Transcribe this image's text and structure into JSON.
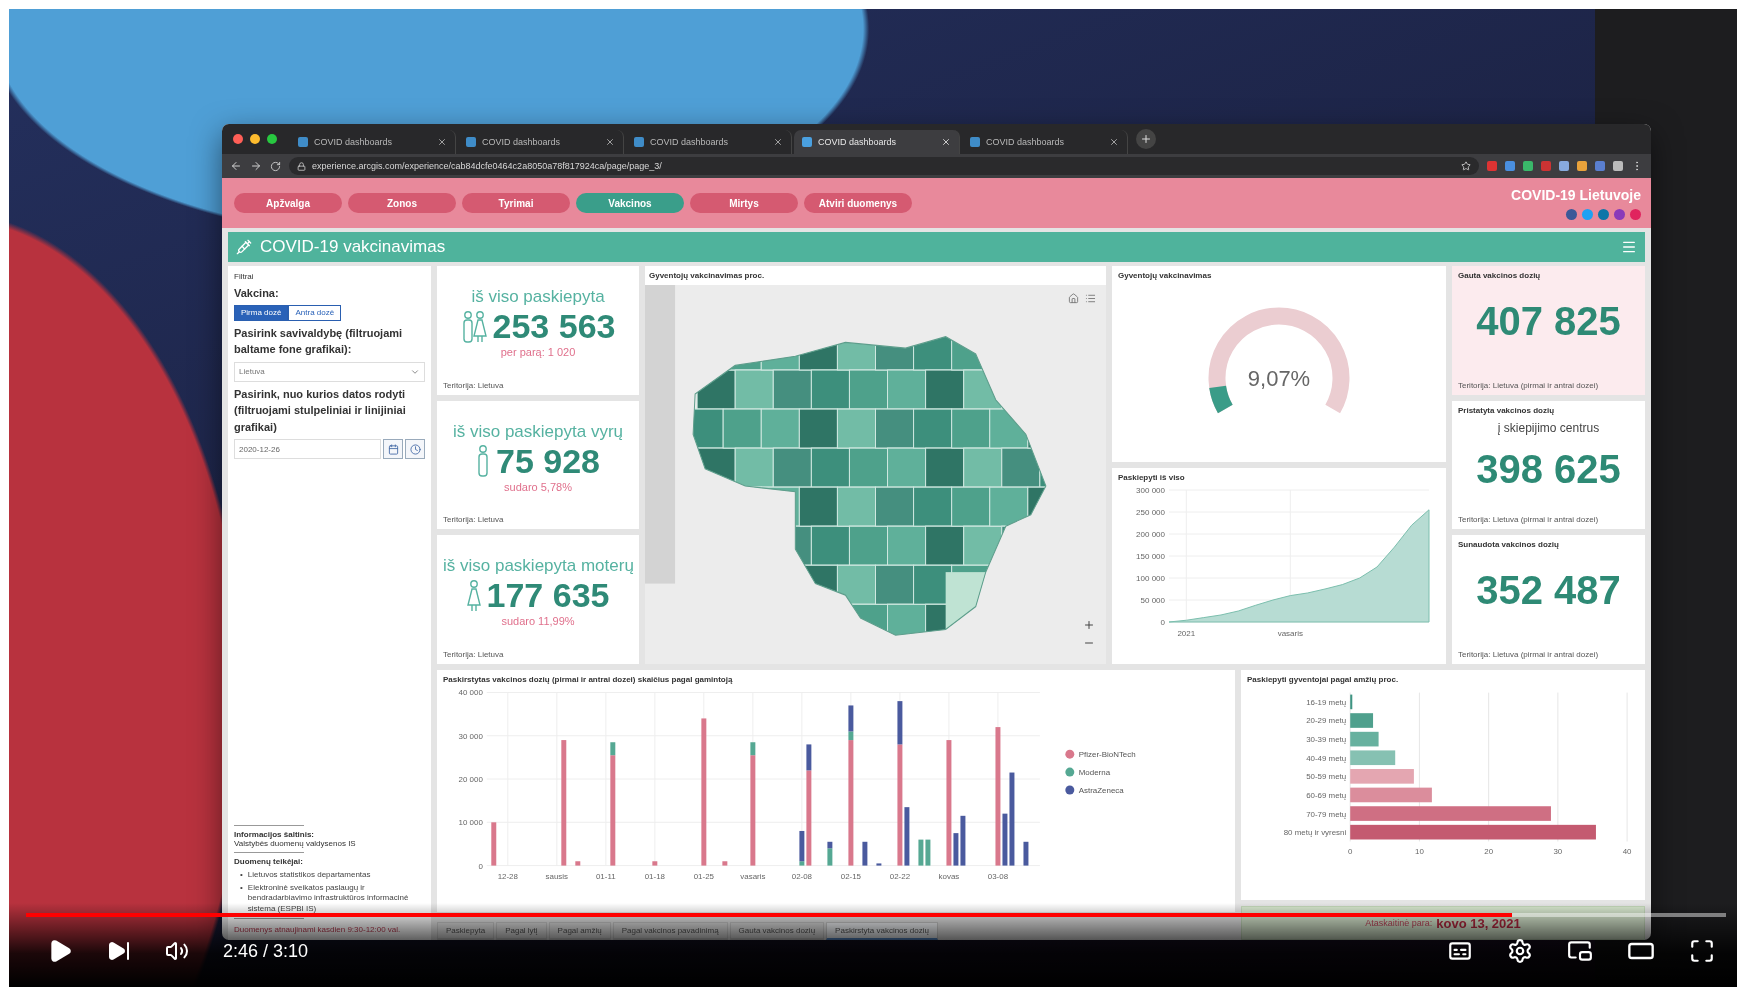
{
  "browser": {
    "tabs": [
      {
        "title": "COVID dashboards",
        "selected": false
      },
      {
        "title": "COVID dashboards",
        "selected": false
      },
      {
        "title": "COVID dashboards",
        "selected": false
      },
      {
        "title": "COVID dashboards",
        "selected": true
      },
      {
        "title": "COVID dashboards",
        "selected": false
      }
    ],
    "url": "experience.arcgis.com/experience/cab84dcfe0464c2a8050a78f817924ca/page/page_3/"
  },
  "nav": {
    "items": [
      {
        "label": "Apžvalga",
        "selected": false
      },
      {
        "label": "Zonos",
        "selected": false
      },
      {
        "label": "Tyrimai",
        "selected": false
      },
      {
        "label": "Vakcinos",
        "selected": true
      },
      {
        "label": "Mirtys",
        "selected": false
      },
      {
        "label": "Atviri duomenys",
        "selected": false
      }
    ],
    "site_title": "COVID-19 Lietuvoje"
  },
  "header": {
    "title": "COVID-19 vakcinavimas"
  },
  "filters": {
    "title": "Filtrai",
    "vaccine_label": "Vakcina:",
    "dose_options": [
      {
        "label": "Pirma dozė",
        "selected": true
      },
      {
        "label": "Antra dozė",
        "selected": false
      }
    ],
    "municipality_label": "Pasirink savivaldybę (filtruojami baltame fone grafikai):",
    "municipality_value": "Lietuva",
    "date_label": "Pasirink, nuo kurios datos rodyti (filtruojami stulpeliniai ir linijiniai grafikai)",
    "date_value": "2020-12-26",
    "source_label": "Informacijos šaltinis:",
    "source_value": "Valstybės duomenų valdysenos IS",
    "providers_label": "Duomenų teikėjai:",
    "providers": [
      {
        "marker": "•",
        "text": "Lietuvos statistikos departamentas"
      },
      {
        "marker": "•",
        "text": "Elektroninė sveikatos paslaugų ir bendradarbiavimo infrastruktūros informacinė sistema (ESPBI IS)"
      }
    ],
    "update_note": "Duomenys atnaujinami kasdien 9:30-12:00 val."
  },
  "kpis": [
    {
      "kind": "group",
      "title": "iš viso paskiepyta",
      "value": "253 563",
      "note": "per parą: 1 020",
      "footer": "Teritorija: Lietuva"
    },
    {
      "kind": "male",
      "title": "iš viso paskiepyta vyrų",
      "value": "75 928",
      "note": "sudaro 5,78%",
      "footer": "Teritorija: Lietuva"
    },
    {
      "kind": "female",
      "title": "iš viso paskiepyta moterų",
      "value": "177 635",
      "note": "sudaro 11,99%",
      "footer": "Teritorija: Lietuva"
    }
  ],
  "map": {
    "title": "Gyventojų vakcinavimas proc."
  },
  "gauge": {
    "title": "Gyventojų vakcinavimas",
    "level": 0.0907,
    "reading": "9,07%"
  },
  "line_chart": {
    "chart_data": {
      "type": "area",
      "title": "Paskiepyti iš viso",
      "categories": [
        null,
        "2021",
        null,
        null,
        null,
        null,
        null,
        "vasaris",
        null,
        null,
        null,
        null,
        null,
        null,
        null,
        null
      ],
      "series": [
        {
          "color": "#b7dcd3",
          "values": [
            0,
            4000,
            10000,
            16000,
            25000,
            38000,
            50000,
            60000,
            66000,
            75000,
            85000,
            100000,
            125000,
            170000,
            220000,
            255000
          ]
        }
      ],
      "ylim": [
        0,
        300000
      ],
      "grid": true,
      "yticks": [
        {
          "value": 0,
          "label": "0"
        },
        {
          "value": 50000,
          "label": "50 000"
        },
        {
          "value": 100000,
          "label": "100 000"
        },
        {
          "value": 150000,
          "label": "150 000"
        },
        {
          "value": 200000,
          "label": "200 000"
        },
        {
          "value": 250000,
          "label": "250 000"
        },
        {
          "value": 300000,
          "label": "300 000"
        }
      ]
    }
  },
  "dose_cards": [
    {
      "title": "Gauta vakcinos dozių",
      "value": "407 825",
      "footer": "Teritorija: Lietuva (pirmai ir antrai dozei)",
      "highlighted": true
    },
    {
      "title": "Pristatyta vakcinos dozių",
      "subtitle": "į skiepijimo centrus",
      "value": "398 625",
      "footer": "Teritorija: Lietuva (pirmai ir antrai dozei)",
      "highlighted": false
    },
    {
      "title": "Sunaudota vakcinos dozių",
      "value": "352 487",
      "footer": "Teritorija: Lietuva (pirmai ir antrai dozei)",
      "highlighted": false
    }
  ],
  "bar_chart": {
    "chart_data": {
      "type": "bar",
      "stacked": true,
      "title": "Paskirstytas vakcinos dozių (pirmai ir antrai dozei) skaičius pagal gamintoją",
      "categories": [
        null,
        null,
        "12-28",
        null,
        null,
        null,
        null,
        null,
        null,
        "sausis",
        null,
        null,
        null,
        null,
        null,
        null,
        "01-11",
        null,
        null,
        null,
        null,
        null,
        null,
        "01-18",
        null,
        null,
        null,
        null,
        null,
        null,
        "01-25",
        null,
        null,
        null,
        null,
        null,
        null,
        "vasaris",
        null,
        null,
        null,
        null,
        null,
        null,
        "02-08",
        null,
        null,
        null,
        null,
        null,
        null,
        "02-15",
        null,
        null,
        null,
        null,
        null,
        null,
        "02-22",
        null,
        null,
        null,
        null,
        null,
        null,
        "kovas",
        null,
        null,
        null,
        null,
        null,
        null,
        "03-08",
        null,
        null,
        null,
        null,
        null
      ],
      "series": [
        {
          "name": "Pfizer-BioNTech",
          "color": "#d9788c",
          "values": [
            10000,
            null,
            null,
            null,
            null,
            null,
            null,
            null,
            null,
            null,
            29000,
            null,
            1000,
            null,
            null,
            null,
            null,
            25500,
            null,
            null,
            null,
            null,
            null,
            1000,
            null,
            null,
            null,
            null,
            null,
            null,
            34000,
            null,
            null,
            1000,
            null,
            null,
            null,
            25500,
            null,
            null,
            null,
            null,
            null,
            null,
            null,
            22000,
            null,
            null,
            null,
            null,
            null,
            29000,
            null,
            null,
            null,
            null,
            null,
            null,
            28000,
            null,
            null,
            null,
            null,
            null,
            null,
            29000,
            null,
            null,
            null,
            null,
            null,
            null,
            32000,
            null,
            null,
            null,
            null,
            null
          ]
        },
        {
          "name": "Moderna",
          "color": "#55a893",
          "values": [
            null,
            null,
            null,
            null,
            null,
            null,
            null,
            null,
            null,
            null,
            null,
            null,
            null,
            null,
            null,
            null,
            null,
            3000,
            null,
            null,
            null,
            null,
            null,
            null,
            null,
            null,
            null,
            null,
            null,
            null,
            null,
            null,
            null,
            null,
            null,
            null,
            null,
            3000,
            null,
            null,
            null,
            null,
            null,
            null,
            1000,
            null,
            null,
            null,
            4000,
            null,
            null,
            2000,
            null,
            null,
            null,
            null,
            null,
            null,
            null,
            null,
            null,
            6000,
            6000,
            null,
            null,
            null,
            null,
            null,
            null,
            null,
            null,
            null,
            null,
            null,
            null,
            null,
            null,
            null
          ]
        },
        {
          "name": "AstraZeneca",
          "color": "#4a5a9e",
          "values": [
            null,
            null,
            null,
            null,
            null,
            null,
            null,
            null,
            null,
            null,
            null,
            null,
            null,
            null,
            null,
            null,
            null,
            null,
            null,
            null,
            null,
            null,
            null,
            null,
            null,
            null,
            null,
            null,
            null,
            null,
            null,
            null,
            null,
            null,
            null,
            null,
            null,
            null,
            null,
            null,
            null,
            null,
            null,
            null,
            7000,
            6000,
            null,
            null,
            1500,
            null,
            null,
            6000,
            null,
            5500,
            null,
            500,
            null,
            null,
            10000,
            13500,
            null,
            null,
            null,
            null,
            null,
            null,
            7500,
            11500,
            null,
            null,
            null,
            null,
            null,
            12000,
            21500,
            null,
            5500,
            null
          ]
        }
      ],
      "ylim": [
        0,
        40000
      ],
      "grid": true,
      "legend": "right",
      "yticks": [
        {
          "value": 0,
          "label": "0"
        },
        {
          "value": 10000,
          "label": "10 000"
        },
        {
          "value": 20000,
          "label": "20 000"
        },
        {
          "value": 30000,
          "label": "30 000"
        },
        {
          "value": 40000,
          "label": "40 000"
        }
      ]
    }
  },
  "age_chart": {
    "chart_data": {
      "type": "bar",
      "orientation": "horizontal",
      "title": "Paskiepyti gyventojai pagal amžių proc.",
      "categories": [
        "16-19 metų",
        "20-29 metų",
        "30-39 metų",
        "40-49 metų",
        "50-59 metų",
        "60-69 metų",
        "70-79 metų",
        "80 metų ir vyresni"
      ],
      "values": [
        0.3,
        3.3,
        4.1,
        6.5,
        9.2,
        11.8,
        29,
        35.5
      ],
      "xlim": [
        0,
        40
      ],
      "xticks": [
        0,
        10,
        20,
        30,
        40
      ],
      "grid": true
    }
  },
  "report_date": {
    "label": "Ataskaitinė para:",
    "value": "kovo 13, 2021"
  },
  "bottom_tabs": [
    {
      "label": "Paskiepyta",
      "selected": false
    },
    {
      "label": "Pagal lytį",
      "selected": false
    },
    {
      "label": "Pagal amžių",
      "selected": false
    },
    {
      "label": "Pagal vakcinos pavadinimą",
      "selected": false
    },
    {
      "label": "Gauta vakcinos dozių",
      "selected": false
    },
    {
      "label": "Paskirstyta vakcinos dozių",
      "selected": true
    }
  ],
  "video": {
    "level": 0.874,
    "time": "2:46 / 3:10"
  }
}
